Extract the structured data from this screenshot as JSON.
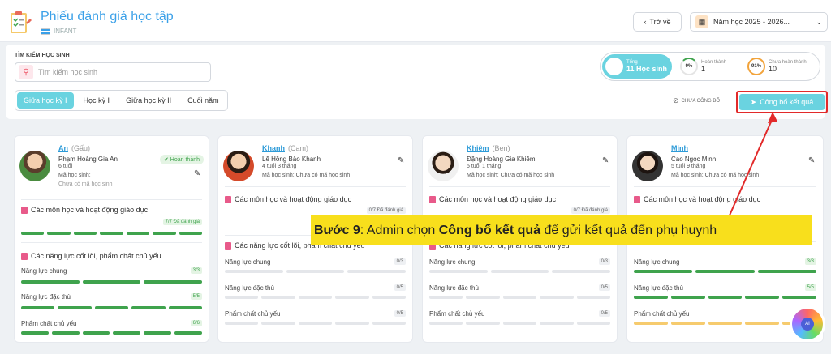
{
  "header": {
    "title": "Phiếu đánh giá học tập",
    "subtitle": "INFANT",
    "back_label": "Trở về",
    "year_label": "Năm học 2025 - 2026..."
  },
  "filters": {
    "search_label": "TÌM KIẾM HỌC SINH",
    "search_placeholder": "Tìm kiếm học sinh",
    "tabs": [
      "Giữa học kỳ I",
      "Học kỳ I",
      "Giữa học kỳ II",
      "Cuối năm"
    ],
    "active_tab": 0
  },
  "stats": {
    "total_label": "Tổng",
    "total_value": "11 Học sinh",
    "done_pct": "9%",
    "done_label": "Hoàn thành",
    "done_value": "1",
    "pending_pct": "91%",
    "pending_label": "Chưa hoàn thành",
    "pending_value": "10"
  },
  "actions": {
    "unpublished_label": "CHƯA CÔNG BỐ",
    "publish_label": "Công bố kết quả"
  },
  "section_titles": {
    "subjects": "Các môn học và hoạt động giáo dục",
    "competencies": "Các năng lực cốt lõi, phẩm chất chủ yếu"
  },
  "row_labels": {
    "general": "Năng lực chung",
    "specific": "Năng lực đặc thù",
    "quality": "Phẩm chất chủ yếu"
  },
  "students": [
    {
      "nick": "An",
      "alias": "(Gấu)",
      "full": "Phạm Hoàng Gia An",
      "age": "6 tuổi",
      "code_label": "Mã học sinh:",
      "code_value": "Chưa có mã học sinh",
      "status": "Hoàn thành",
      "subjects": "7/7 Đã đánh giá",
      "general": "3/3",
      "specific": "5/5",
      "quality": "6/6"
    },
    {
      "nick": "Khanh",
      "alias": "(Cam)",
      "full": "Lê Hồng Bảo Khanh",
      "age": "4 tuổi 3 tháng",
      "code_label": "Mã học sinh: Chưa có mã học sinh",
      "subjects": "0/7 Đã đánh giá",
      "general": "0/3",
      "specific": "0/5",
      "quality": "0/5"
    },
    {
      "nick": "Khiêm",
      "alias": "(Ben)",
      "full": "Đặng Hoàng Gia Khiêm",
      "age": "5 tuổi 1 tháng",
      "code_label": "Mã học sinh: Chưa có mã học sinh",
      "subjects": "0/7 Đã đánh giá",
      "general": "0/3",
      "specific": "0/5",
      "quality": "0/5"
    },
    {
      "nick": "Minh",
      "alias": "",
      "full": "Cao Ngọc Minh",
      "age": "5 tuổi 9 tháng",
      "code_label": "Mã học sinh: Chưa có mã học sinh",
      "subjects": "7/7 Đã đánh giá",
      "general": "3/3",
      "specific": "5/5",
      "quality": ""
    }
  ],
  "annotation": {
    "step": "Bước 9",
    "text1": ": Admin chọn ",
    "bold": "Công bố kết quả",
    "text2": " để gửi kết quả đến phụ huynh"
  },
  "colors": {
    "accent": "#6ad3e0",
    "title": "#3aa0e8",
    "success": "#3fa34d",
    "highlight": "#e22a2a",
    "callout": "#f8df1c"
  }
}
